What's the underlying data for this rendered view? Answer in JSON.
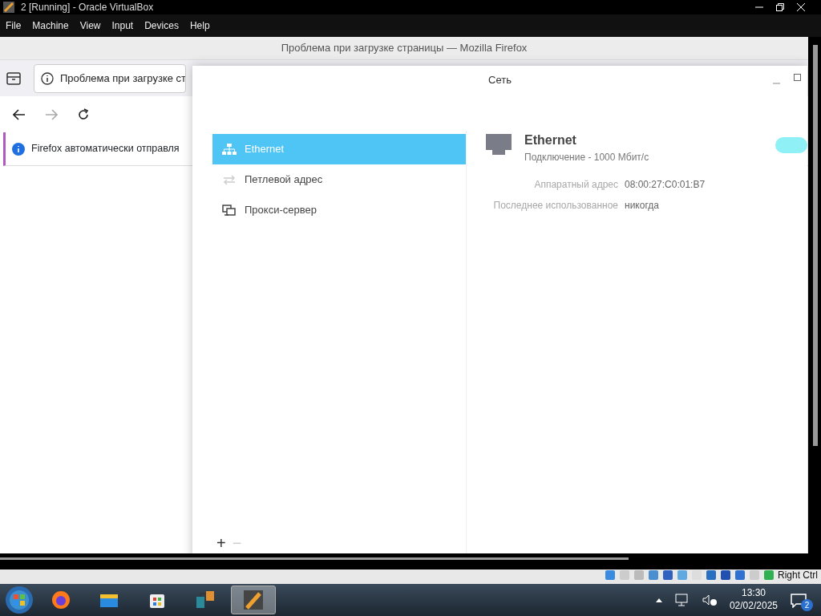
{
  "vm_window": {
    "title": "2 [Running] - Oracle VirtualBox"
  },
  "menu": [
    "File",
    "Machine",
    "View",
    "Input",
    "Devices",
    "Help"
  ],
  "firefox": {
    "title": "Проблема при загрузке страницы — Mozilla Firefox",
    "tab_title": "Проблема при загрузке ст",
    "notification": "Firefox автоматически отправля"
  },
  "network_dialog": {
    "title": "Сеть",
    "sidebar": [
      {
        "kind": "ethernet",
        "label": "Ethernet",
        "selected": true
      },
      {
        "kind": "loopback",
        "label": "Петлевой адрес",
        "selected": false
      },
      {
        "kind": "proxy",
        "label": "Прокси-сервер",
        "selected": false
      }
    ],
    "connection": {
      "name": "Ethernet",
      "status": "Подключение - 1000 Мбит/с",
      "on": true
    },
    "details": [
      {
        "label": "Аппаратный адрес",
        "value": "08:00:27:C0:01:B7"
      },
      {
        "label": "Последнее использованное",
        "value": "никогда"
      }
    ],
    "footer_buttons": [
      "+",
      "−"
    ]
  },
  "status_bar": {
    "host_key": "Right Ctrl"
  },
  "taskbar": {
    "apps": [
      {
        "kind": "firefox",
        "selected": false
      },
      {
        "kind": "explorer",
        "selected": false
      },
      {
        "kind": "store",
        "selected": false
      },
      {
        "kind": "app",
        "selected": false
      },
      {
        "kind": "virtualbox",
        "selected": true
      }
    ],
    "time": "13:30",
    "date": "02/02/2025",
    "notification_count": "2"
  }
}
